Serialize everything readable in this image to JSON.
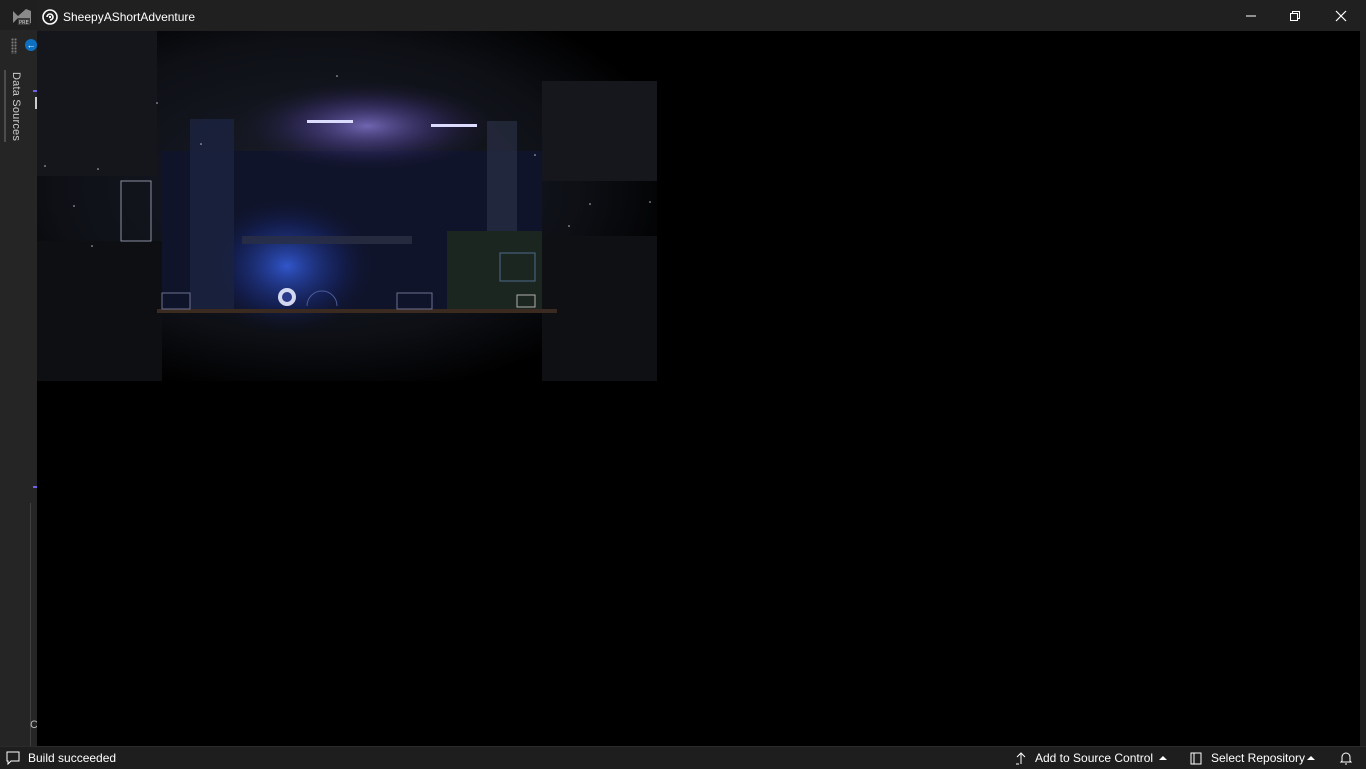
{
  "window": {
    "title": "SheepyAShortAdventure",
    "controls": {
      "minimize": "minimize-icon",
      "maximize": "restore-icon",
      "close": "close-icon"
    }
  },
  "ide": {
    "side_tab_label": "Data Sources",
    "partial_letter": "C"
  },
  "status_bar": {
    "build_status": "Build succeeded",
    "add_to_source_control": "Add to Source Control",
    "select_repository": "Select Repository"
  },
  "colors": {
    "accent": "#0e70c0",
    "titlebar": "#202020",
    "statusbar": "#1e1e1e",
    "viewport": "#000000"
  }
}
